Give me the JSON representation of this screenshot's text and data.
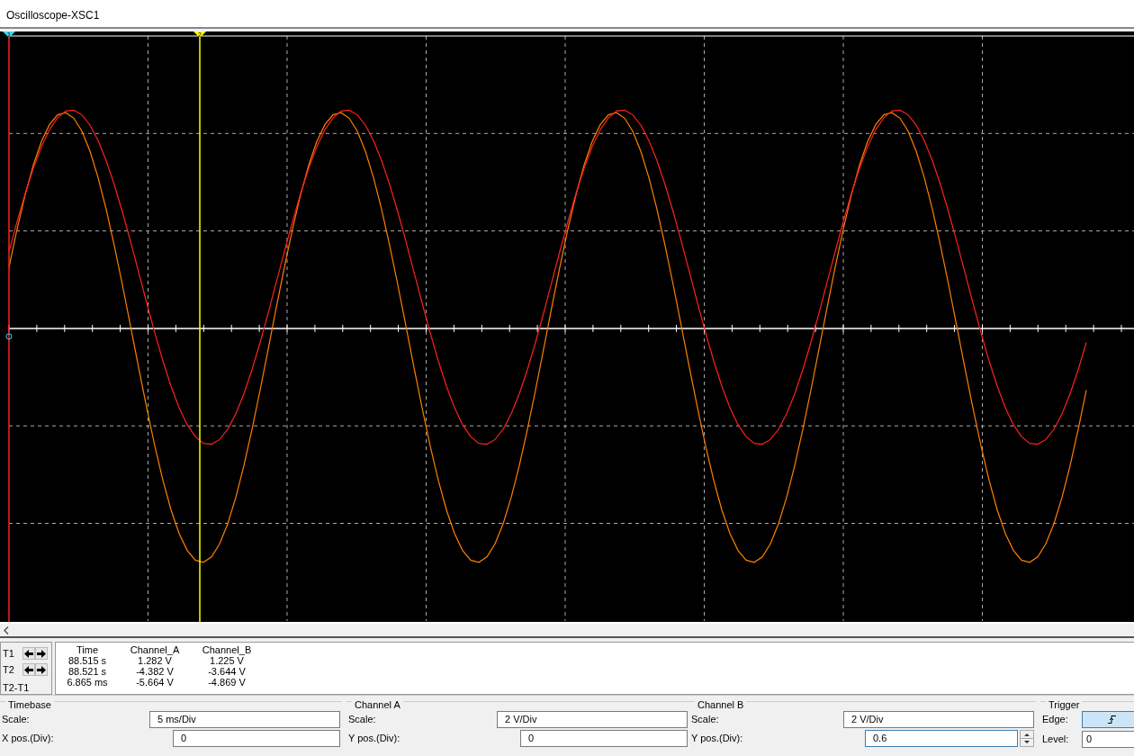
{
  "window": {
    "title": "Oscilloscope-XSC1"
  },
  "cursors": [
    {
      "label": "1",
      "color": "#3fd6e8"
    },
    {
      "label": "2",
      "color": "#ffff00"
    }
  ],
  "readout": {
    "columns": [
      "Time",
      "Channel_A",
      "Channel_B"
    ],
    "rows": [
      {
        "label": "T1",
        "kind": "cursor",
        "cells": [
          "88.515 s",
          "1.282 V",
          "1.225 V"
        ]
      },
      {
        "label": "T2",
        "kind": "cursor",
        "cells": [
          "88.521 s",
          "-4.382 V",
          "-3.644 V"
        ]
      },
      {
        "label": "T2-T1",
        "kind": "difference",
        "cells": [
          "6.865 ms",
          "-5.664 V",
          "-4.869 V"
        ]
      }
    ]
  },
  "groups": [
    {
      "title": "Timebase",
      "fields": [
        {
          "label": "Scale:",
          "value": "5 ms/Div",
          "kind": "wide"
        },
        {
          "label": "X pos.(Div):",
          "value": "0",
          "kind": "narrow"
        }
      ]
    },
    {
      "title": "Channel A",
      "fields": [
        {
          "label": "Scale:",
          "value": "2  V/Div",
          "kind": "wide"
        },
        {
          "label": "Y pos.(Div):",
          "value": "0",
          "kind": "narrow"
        }
      ]
    },
    {
      "title": "Channel B",
      "fields": [
        {
          "label": "Scale:",
          "value": "2  V/Div",
          "kind": "wide"
        },
        {
          "label": "Y pos.(Div):",
          "value": "0.6",
          "kind": "spin"
        }
      ]
    },
    {
      "title": "Trigger",
      "fields": [
        {
          "label": "Edge:",
          "kind": "edge"
        },
        {
          "label": "Level:",
          "value": "0",
          "kind": "level"
        }
      ]
    }
  ]
}
